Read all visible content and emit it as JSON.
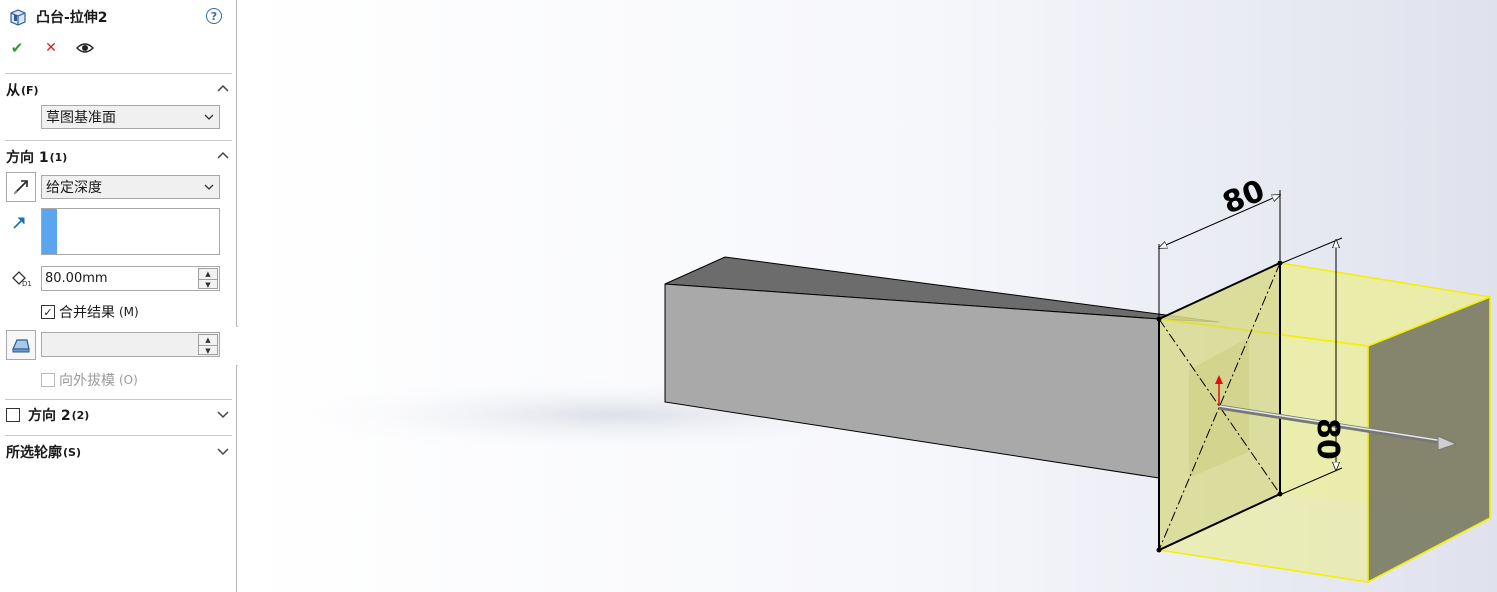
{
  "feature": {
    "title": "凸台-拉伸2",
    "icon": "boss-extrude-icon",
    "help_icon": "help-icon",
    "actions": {
      "ok_icon": "checkmark-icon",
      "cancel_icon": "close-icon",
      "preview_icon": "eye-icon"
    }
  },
  "from_section": {
    "label": "从",
    "shortcut": "(F)",
    "value": "草图基准面"
  },
  "direction1": {
    "label": "方向 1",
    "shortcut": "(1)",
    "end_condition": "给定深度",
    "depth": "80.00mm",
    "merge_result": {
      "label": "合并结果",
      "shortcut": "(M)",
      "checked": true
    },
    "draft_value": "",
    "draft_outward": {
      "label": "向外拔模",
      "shortcut": "(O)",
      "checked": false,
      "enabled": false
    }
  },
  "direction2": {
    "label": "方向 2",
    "shortcut": "(2)",
    "checked": false
  },
  "selected_contours": {
    "label": "所选轮廓",
    "shortcut": "(S)"
  },
  "viewport": {
    "dim_width": "80",
    "dim_height": "80",
    "colors": {
      "preview_fill": "#e9ec9e",
      "preview_edge": "#f5f000",
      "bar_front": "#a9a9a9",
      "bar_top": "#6c6c6c",
      "bar_side": "#8f8f8f"
    }
  }
}
